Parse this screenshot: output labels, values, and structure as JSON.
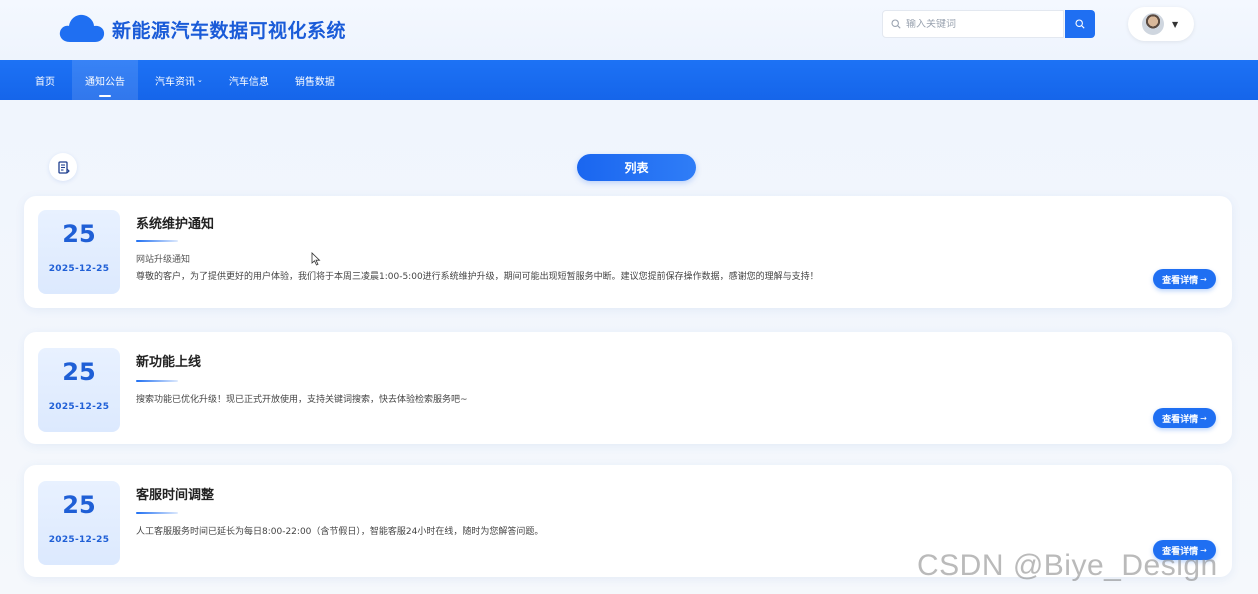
{
  "app": {
    "title": "新能源汽车数据可视化系统"
  },
  "search": {
    "placeholder": "输入关键词"
  },
  "nav": {
    "items": [
      {
        "label": "首页"
      },
      {
        "label": "通知公告"
      },
      {
        "label": "汽车资讯"
      },
      {
        "label": "汽车信息"
      },
      {
        "label": "销售数据"
      }
    ],
    "active": "通知公告"
  },
  "tab": {
    "label": "列表"
  },
  "notices": [
    {
      "day": "25",
      "date": "2025-12-25",
      "title": "系统维护通知",
      "subtitle": "网站升级通知",
      "body": "尊敬的客户，为了提供更好的用户体验，我们将于本周三凌晨1:00-5:00进行系统维护升级，期间可能出现短暂服务中断。建议您提前保存操作数据，感谢您的理解与支持！",
      "button": "查看详情"
    },
    {
      "day": "25",
      "date": "2025-12-25",
      "title": "新功能上线",
      "subtitle": "",
      "body": "搜索功能已优化升级！现已正式开放使用，支持关键词搜索，快去体验检索服务吧~",
      "button": "查看详情"
    },
    {
      "day": "25",
      "date": "2025-12-25",
      "title": "客服时间调整",
      "subtitle": "",
      "body": "人工客服服务时间已延长为每日8:00-22:00（含节假日），智能客服24小时在线，随时为您解答问题。",
      "button": "查看详情"
    }
  ],
  "watermark": "CSDN @Biye_Design",
  "colors": {
    "primary": "#1f6ff2",
    "nav": "#1565ea",
    "title": "#1a5bd8"
  }
}
